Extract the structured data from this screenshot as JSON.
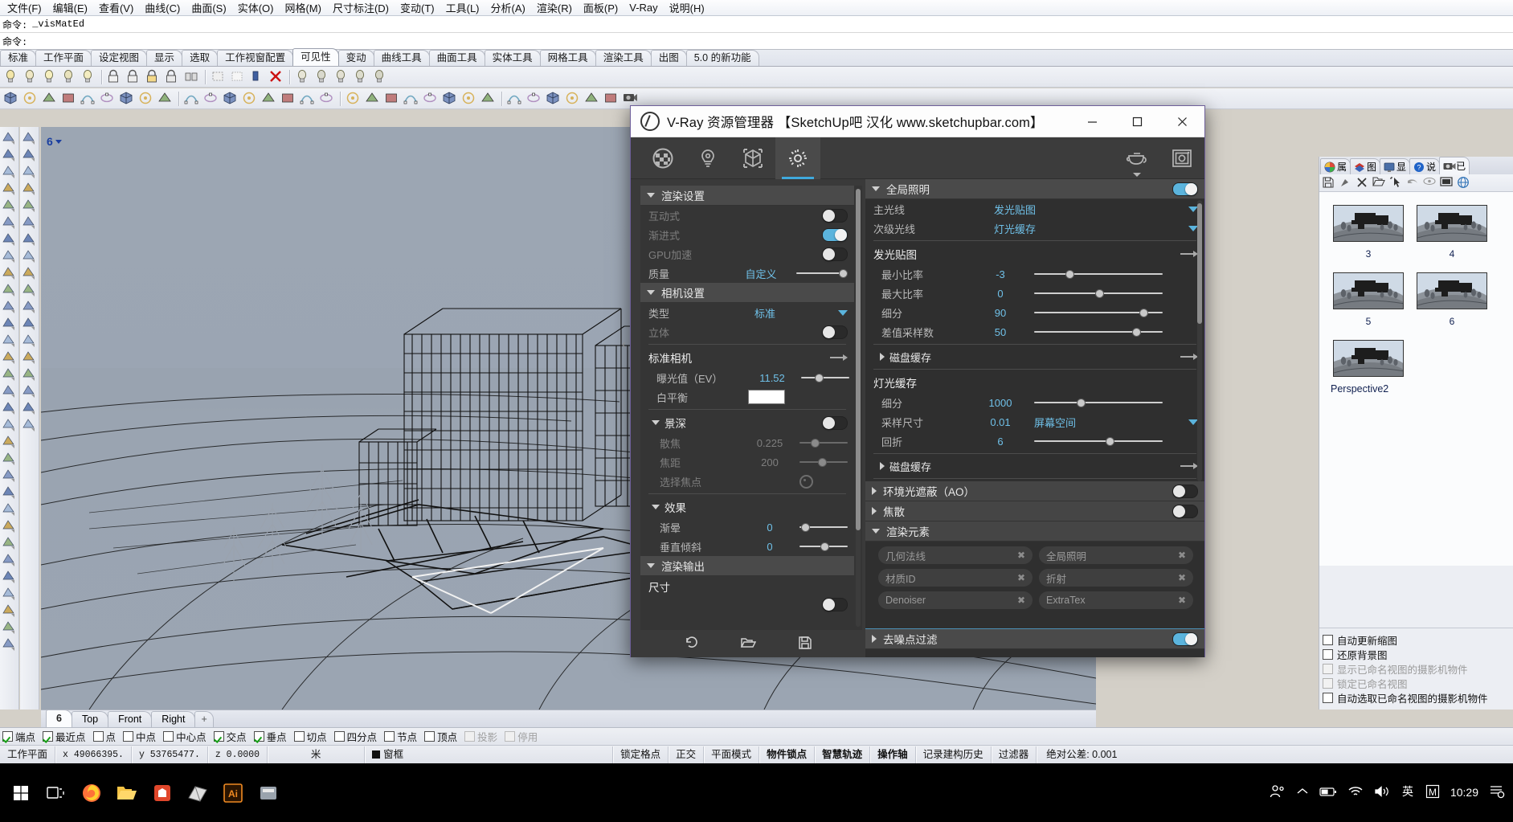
{
  "menubar": {
    "items": [
      "文件(F)",
      "编辑(E)",
      "查看(V)",
      "曲线(C)",
      "曲面(S)",
      "实体(O)",
      "网格(M)",
      "尺寸标注(D)",
      "变动(T)",
      "工具(L)",
      "分析(A)",
      "渲染(R)",
      "面板(P)",
      "V-Ray",
      "说明(H)"
    ]
  },
  "command": {
    "line1_prompt": "命令:",
    "line1_text": "_visMatEd",
    "line2_prompt": "命令:",
    "line2_text": ""
  },
  "ribbon": {
    "tabs": [
      "标准",
      "工作平面",
      "设定视图",
      "显示",
      "选取",
      "工作视窗配置",
      "可见性",
      "变动",
      "曲线工具",
      "曲面工具",
      "实体工具",
      "网格工具",
      "渲染工具",
      "出图",
      "5.0 的新功能"
    ],
    "active": "可见性"
  },
  "viewport": {
    "label": "6",
    "view_tabs": [
      "6",
      "Top",
      "Front",
      "Right"
    ],
    "active_view_tab": "6",
    "add_tab_label": "+"
  },
  "right_panel": {
    "tabs": [
      {
        "label": "属",
        "icon": "color-wheel-icon"
      },
      {
        "label": "图",
        "icon": "layers-icon"
      },
      {
        "label": "显",
        "icon": "display-icon"
      },
      {
        "label": "说",
        "icon": "help-icon"
      },
      {
        "label": "已",
        "icon": "camera-icon"
      }
    ],
    "active_tab": "已",
    "toolbar_icons": [
      "save-icon",
      "restore-icon",
      "delete-icon",
      "folder-icon",
      "pick-icon",
      "undo-icon",
      "eye-icon",
      "filmstrip-icon",
      "globe-icon"
    ],
    "named_views": [
      {
        "label": "3"
      },
      {
        "label": "4"
      },
      {
        "label": "5"
      },
      {
        "label": "6"
      },
      {
        "label": "Perspective2"
      }
    ],
    "checkboxes": [
      {
        "label": "自动更新缩图",
        "checked": false,
        "disabled": false
      },
      {
        "label": "还原背景图",
        "checked": false,
        "disabled": false
      },
      {
        "label": "显示已命名视图的摄影机物件",
        "checked": false,
        "disabled": true
      },
      {
        "label": "锁定已命名视图",
        "checked": false,
        "disabled": true
      },
      {
        "label": "自动选取已命名视图的摄影机物件",
        "checked": false,
        "disabled": false
      }
    ]
  },
  "snapbar": {
    "items": [
      {
        "label": "端点",
        "checked": true,
        "disabled": false
      },
      {
        "label": "最近点",
        "checked": true,
        "disabled": false
      },
      {
        "label": "点",
        "checked": false,
        "disabled": false
      },
      {
        "label": "中点",
        "checked": false,
        "disabled": false
      },
      {
        "label": "中心点",
        "checked": false,
        "disabled": false
      },
      {
        "label": "交点",
        "checked": true,
        "disabled": false
      },
      {
        "label": "垂点",
        "checked": true,
        "disabled": false
      },
      {
        "label": "切点",
        "checked": false,
        "disabled": false
      },
      {
        "label": "四分点",
        "checked": false,
        "disabled": false
      },
      {
        "label": "节点",
        "checked": false,
        "disabled": false
      },
      {
        "label": "顶点",
        "checked": false,
        "disabled": false
      },
      {
        "label": "投影",
        "checked": false,
        "disabled": true
      },
      {
        "label": "停用",
        "checked": false,
        "disabled": true
      }
    ]
  },
  "statusbar": {
    "workplane": "工作平面",
    "coord_x": "x  49066395.",
    "coord_y": "y  53765477.",
    "coord_z": "z  0.0000",
    "unit": "米",
    "layer": "窗框",
    "cells": [
      "锁定格点",
      "正交",
      "平面模式",
      "物件锁点",
      "智慧轨迹",
      "操作轴",
      "记录建构历史",
      "过滤器"
    ],
    "bold_cells": [
      "物件锁点",
      "智慧轨迹",
      "操作轴"
    ],
    "tolerance": "绝对公差: 0.001"
  },
  "taskbar": {
    "clock_time": "10:29",
    "tray_icons": [
      "people-icon",
      "chevron-up-icon",
      "battery-icon",
      "wifi-icon",
      "volume-icon",
      "ime-icon",
      "m-icon"
    ],
    "app_icons": [
      "windows-start-icon",
      "task-view-icon",
      "firefox-icon",
      "explorer-icon",
      "store-icon",
      "sketchup-icon",
      "ai-icon",
      "app-icon"
    ]
  },
  "vray": {
    "title": "V-Ray 资源管理器 【SketchUp吧 汉化 www.sketchupbar.com】",
    "window_buttons": {
      "minimize": "—",
      "maximize": "☐",
      "close": "✕"
    },
    "toolbar_icons": [
      {
        "name": "material-sphere-icon",
        "active": false
      },
      {
        "name": "light-bulb-icon",
        "active": false
      },
      {
        "name": "geometry-cube-icon",
        "active": false
      },
      {
        "name": "settings-gear-icon",
        "active": true
      },
      {
        "name": "render-teapot-icon",
        "active": false
      },
      {
        "name": "render-frame-icon",
        "active": false
      }
    ],
    "left": {
      "section_render": "渲染设置",
      "rows": [
        {
          "label": "互动式",
          "type": "toggle",
          "on": false,
          "dim": true
        },
        {
          "label": "渐进式",
          "type": "toggle",
          "on": true,
          "dim": true
        },
        {
          "label": "GPU加速",
          "type": "toggle",
          "on": false,
          "dim": true
        },
        {
          "label": "质量",
          "type": "slider-value",
          "value": "自定义",
          "pos": 97,
          "dim": false
        }
      ],
      "section_camera": "相机设置",
      "camera_rows": [
        {
          "label": "类型",
          "type": "dropdown",
          "value": "标准"
        },
        {
          "label": "立体",
          "type": "toggle",
          "on": false,
          "dim": true
        }
      ],
      "standard_camera_title": "标准相机",
      "standard_camera_rows": [
        {
          "label": "曝光值（EV）",
          "type": "slider-value",
          "value": "11.52",
          "pos": 34
        },
        {
          "label": "白平衡",
          "type": "color",
          "value": "#ffffff"
        }
      ],
      "dof_title": "景深",
      "dof_on": false,
      "dof_rows": [
        {
          "label": "散焦",
          "value": "0.225",
          "pos": 28,
          "dim": true
        },
        {
          "label": "焦距",
          "value": "200",
          "pos": 45,
          "dim": true
        },
        {
          "label": "选择焦点",
          "value": "",
          "type": "focus-button",
          "dim": true
        }
      ],
      "effects_title": "效果",
      "effects_rows": [
        {
          "label": "渐晕",
          "value": "0",
          "pos": 4
        },
        {
          "label": "垂直倾斜",
          "value": "0",
          "pos": 50
        }
      ],
      "section_output": "渲染输出",
      "output_rows": [
        {
          "label": "尺寸",
          "type": "title"
        }
      ],
      "footer_icons": [
        "reset-icon",
        "open-icon",
        "save-icon"
      ]
    },
    "right": {
      "gi_title": "全局照明",
      "gi_on": true,
      "gi_rows": [
        {
          "label": "主光线",
          "value": "发光贴图",
          "type": "dropdown"
        },
        {
          "label": "次级光线",
          "value": "灯光缓存",
          "type": "dropdown"
        }
      ],
      "irradiance_title": "发光贴图",
      "irradiance_rows": [
        {
          "label": "最小比率",
          "value": "-3",
          "pos": 26
        },
        {
          "label": "最大比率",
          "value": "0",
          "pos": 50
        },
        {
          "label": "细分",
          "value": "90",
          "pos": 87
        },
        {
          "label": "差值采样数",
          "value": "50",
          "pos": 81
        }
      ],
      "irradiance_cache": "磁盘缓存",
      "lightcache_title": "灯光缓存",
      "lightcache_rows": [
        {
          "label": "细分",
          "value": "1000",
          "pos": 35
        },
        {
          "label": "采样尺寸",
          "value": "0.01",
          "value2": "屏幕空间",
          "type": "dropdown"
        },
        {
          "label": "回折",
          "value": "6",
          "pos": 59
        }
      ],
      "lightcache_cache": "磁盘缓存",
      "ao_title": "环境光遮蔽（AO）",
      "ao_on": false,
      "caustics_title": "焦散",
      "caustics_on": false,
      "elements_title": "渲染元素",
      "elements": [
        "几何法线",
        "全局照明",
        "材质ID",
        "折射",
        "Denoiser",
        "ExtraTex"
      ],
      "denoise_title": "去噪点过滤",
      "denoise_on": true
    }
  }
}
